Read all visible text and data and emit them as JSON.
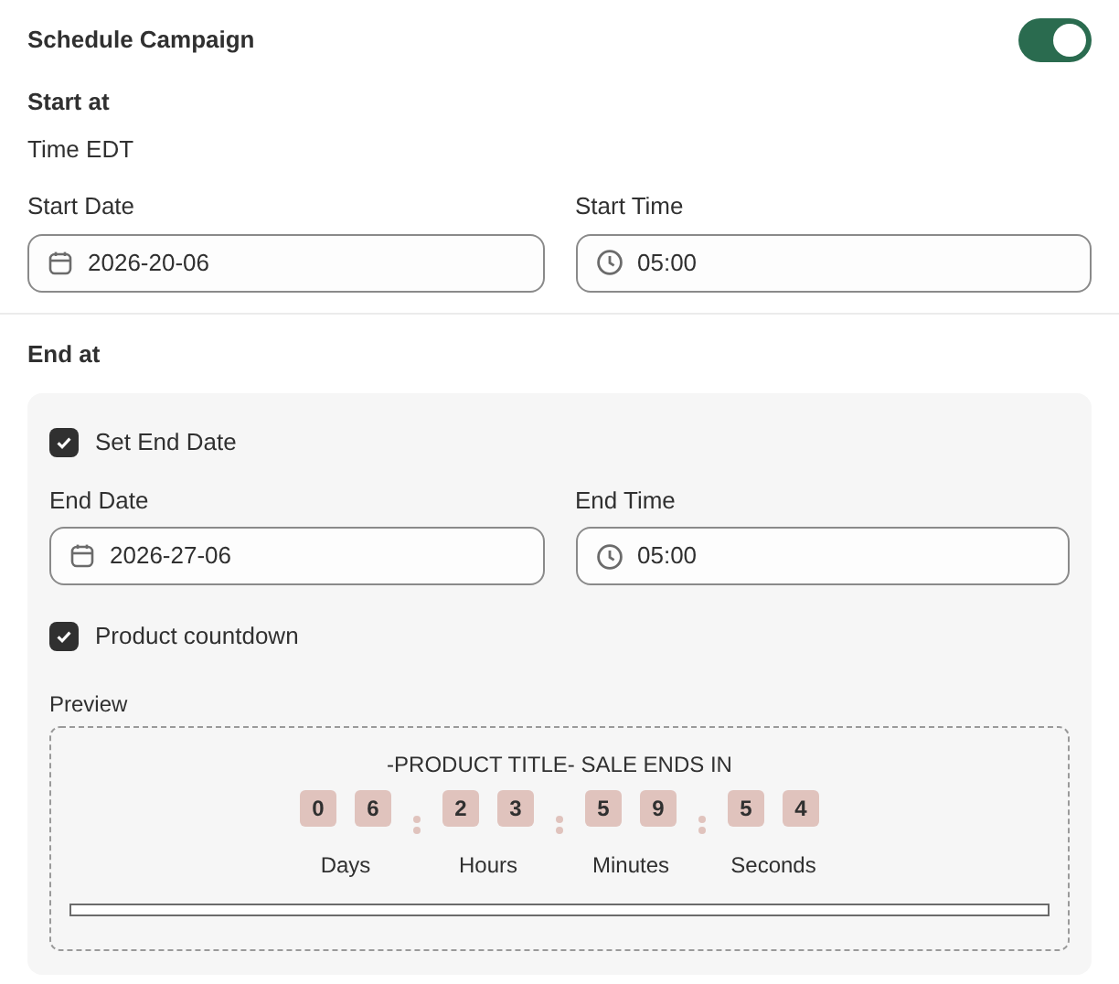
{
  "header": {
    "title": "Schedule Campaign",
    "toggle_on": true
  },
  "start": {
    "heading": "Start at",
    "timezone": "Time EDT",
    "fields": [
      {
        "kind": "date",
        "label": "Start Date",
        "value": "2026-20-06"
      },
      {
        "kind": "time",
        "label": "Start Time",
        "value": "05:00"
      }
    ]
  },
  "end": {
    "heading": "End at",
    "set_end_date": {
      "label": "Set End Date",
      "checked": true
    },
    "fields": [
      {
        "kind": "date",
        "label": "End Date",
        "value": "2026-27-06"
      },
      {
        "kind": "time",
        "label": "End Time",
        "value": "05:00"
      }
    ],
    "countdown": {
      "label": "Product countdown",
      "checked": true
    },
    "preview": {
      "label": "Preview",
      "title": "-PRODUCT TITLE- SALE ENDS IN",
      "units": [
        {
          "digits": [
            "0",
            "6"
          ],
          "label": "Days"
        },
        {
          "digits": [
            "2",
            "3"
          ],
          "label": "Hours"
        },
        {
          "digits": [
            "5",
            "9"
          ],
          "label": "Minutes"
        },
        {
          "digits": [
            "5",
            "4"
          ],
          "label": "Seconds"
        }
      ]
    }
  }
}
